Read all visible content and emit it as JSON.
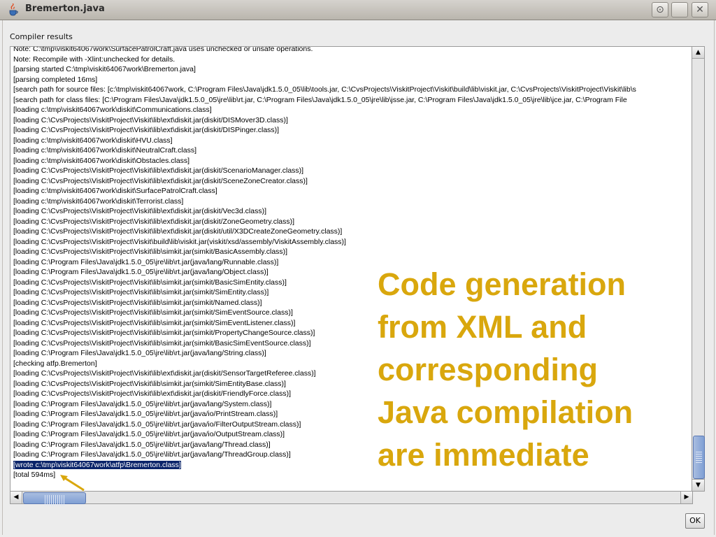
{
  "window": {
    "title": "Bremerton.java"
  },
  "section_label": "Compiler results",
  "log_lines": [
    "Note: C:\\tmp\\viskit64067work\\SurfacePatrolCraft.java uses unchecked or unsafe operations.",
    "Note: Recompile with -Xlint:unchecked for details.",
    "[parsing started C:\\tmp\\viskit64067work\\Bremerton.java]",
    "[parsing completed 16ms]",
    "[search path for source files: [c:\\tmp\\viskit64067work, C:\\Program Files\\Java\\jdk1.5.0_05\\lib\\tools.jar, C:\\CvsProjects\\ViskitProject\\Viskit\\build\\lib\\viskit.jar, C:\\CvsProjects\\ViskitProject\\Viskit\\lib\\s",
    "[search path for class files: [C:\\Program Files\\Java\\jdk1.5.0_05\\jre\\lib\\rt.jar, C:\\Program Files\\Java\\jdk1.5.0_05\\jre\\lib\\jsse.jar, C:\\Program Files\\Java\\jdk1.5.0_05\\jre\\lib\\jce.jar, C:\\Program File",
    "[loading c:\\tmp\\viskit64067work\\diskit\\Communications.class]",
    "[loading C:\\CvsProjects\\ViskitProject\\Viskit\\lib\\ext\\diskit.jar(diskit/DISMover3D.class)]",
    "[loading C:\\CvsProjects\\ViskitProject\\Viskit\\lib\\ext\\diskit.jar(diskit/DISPinger.class)]",
    "[loading c:\\tmp\\viskit64067work\\diskit\\HVU.class]",
    "[loading c:\\tmp\\viskit64067work\\diskit\\NeutralCraft.class]",
    "[loading c:\\tmp\\viskit64067work\\diskit\\Obstacles.class]",
    "[loading C:\\CvsProjects\\ViskitProject\\Viskit\\lib\\ext\\diskit.jar(diskit/ScenarioManager.class)]",
    "[loading C:\\CvsProjects\\ViskitProject\\Viskit\\lib\\ext\\diskit.jar(diskit/SceneZoneCreator.class)]",
    "[loading c:\\tmp\\viskit64067work\\diskit\\SurfacePatrolCraft.class]",
    "[loading c:\\tmp\\viskit64067work\\diskit\\Terrorist.class]",
    "[loading C:\\CvsProjects\\ViskitProject\\Viskit\\lib\\ext\\diskit.jar(diskit/Vec3d.class)]",
    "[loading C:\\CvsProjects\\ViskitProject\\Viskit\\lib\\ext\\diskit.jar(diskit/ZoneGeometry.class)]",
    "[loading C:\\CvsProjects\\ViskitProject\\Viskit\\lib\\ext\\diskit.jar(diskit/util/X3DCreateZoneGeometry.class)]",
    "[loading C:\\CvsProjects\\ViskitProject\\Viskit\\build\\lib\\viskit.jar(viskit/xsd/assembly/ViskitAssembly.class)]",
    "[loading C:\\CvsProjects\\ViskitProject\\Viskit\\lib\\simkit.jar(simkit/BasicAssembly.class)]",
    "[loading C:\\Program Files\\Java\\jdk1.5.0_05\\jre\\lib\\rt.jar(java/lang/Runnable.class)]",
    "[loading C:\\Program Files\\Java\\jdk1.5.0_05\\jre\\lib\\rt.jar(java/lang/Object.class)]",
    "[loading C:\\CvsProjects\\ViskitProject\\Viskit\\lib\\simkit.jar(simkit/BasicSimEntity.class)]",
    "[loading C:\\CvsProjects\\ViskitProject\\Viskit\\lib\\simkit.jar(simkit/SimEntity.class)]",
    "[loading C:\\CvsProjects\\ViskitProject\\Viskit\\lib\\simkit.jar(simkit/Named.class)]",
    "[loading C:\\CvsProjects\\ViskitProject\\Viskit\\lib\\simkit.jar(simkit/SimEventSource.class)]",
    "[loading C:\\CvsProjects\\ViskitProject\\Viskit\\lib\\simkit.jar(simkit/SimEventListener.class)]",
    "[loading C:\\CvsProjects\\ViskitProject\\Viskit\\lib\\simkit.jar(simkit/PropertyChangeSource.class)]",
    "[loading C:\\CvsProjects\\ViskitProject\\Viskit\\lib\\simkit.jar(simkit/BasicSimEventSource.class)]",
    "[loading C:\\Program Files\\Java\\jdk1.5.0_05\\jre\\lib\\rt.jar(java/lang/String.class)]",
    "[checking atfp.Bremerton]",
    "[loading C:\\CvsProjects\\ViskitProject\\Viskit\\lib\\ext\\diskit.jar(diskit/SensorTargetReferee.class)]",
    "[loading C:\\CvsProjects\\ViskitProject\\Viskit\\lib\\simkit.jar(simkit/SimEntityBase.class)]",
    "[loading C:\\CvsProjects\\ViskitProject\\Viskit\\lib\\ext\\diskit.jar(diskit/FriendlyForce.class)]",
    "[loading C:\\Program Files\\Java\\jdk1.5.0_05\\jre\\lib\\rt.jar(java/lang/System.class)]",
    "[loading C:\\Program Files\\Java\\jdk1.5.0_05\\jre\\lib\\rt.jar(java/io/PrintStream.class)]",
    "[loading C:\\Program Files\\Java\\jdk1.5.0_05\\jre\\lib\\rt.jar(java/io/FilterOutputStream.class)]",
    "[loading C:\\Program Files\\Java\\jdk1.5.0_05\\jre\\lib\\rt.jar(java/io/OutputStream.class)]",
    "[loading C:\\Program Files\\Java\\jdk1.5.0_05\\jre\\lib\\rt.jar(java/lang/Thread.class)]",
    "[loading C:\\Program Files\\Java\\jdk1.5.0_05\\jre\\lib\\rt.jar(java/lang/ThreadGroup.class)]",
    "[wrote c:\\tmp\\viskit64067work\\atfp\\Bremerton.class]",
    "[total 594ms]"
  ],
  "highlighted_line": "[wrote c:\\tmp\\viskit64067work\\atfp\\Bremerton.class]",
  "ok_label": "OK",
  "caption_lines": [
    "Code generation",
    "from XML and",
    "corresponding",
    "Java compilation",
    "are immediate"
  ],
  "colors": {
    "caption": "#d9a70d",
    "selection": "#0a246a",
    "arrow": "#d9a70d"
  },
  "icons": {
    "window": "java-cup-icon",
    "buttons": [
      "restore-icon",
      "maximize-icon",
      "close-icon"
    ],
    "scroll": [
      "arrow-up-icon",
      "arrow-down-icon",
      "arrow-left-icon",
      "arrow-right-icon"
    ]
  }
}
